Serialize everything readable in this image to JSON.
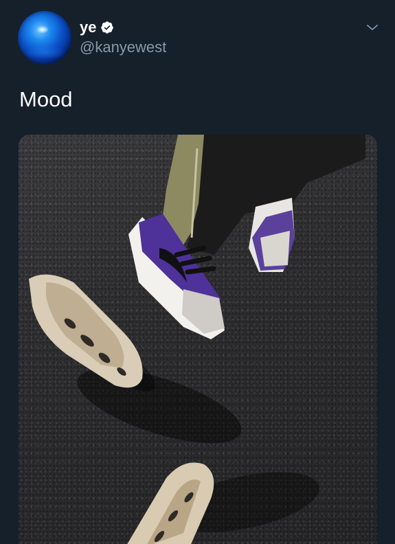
{
  "user": {
    "display_name": "ye",
    "handle": "@kanyewest",
    "verified": true,
    "avatar_icon": "blue-orb-avatar"
  },
  "menu_icon": "chevron-down-icon",
  "tweet": {
    "text": "Mood"
  },
  "media": {
    "type": "photo"
  },
  "colors": {
    "background": "#15202b",
    "text_primary": "#ffffff",
    "text_secondary": "#8899a6",
    "verified_badge": "#ffffff"
  }
}
